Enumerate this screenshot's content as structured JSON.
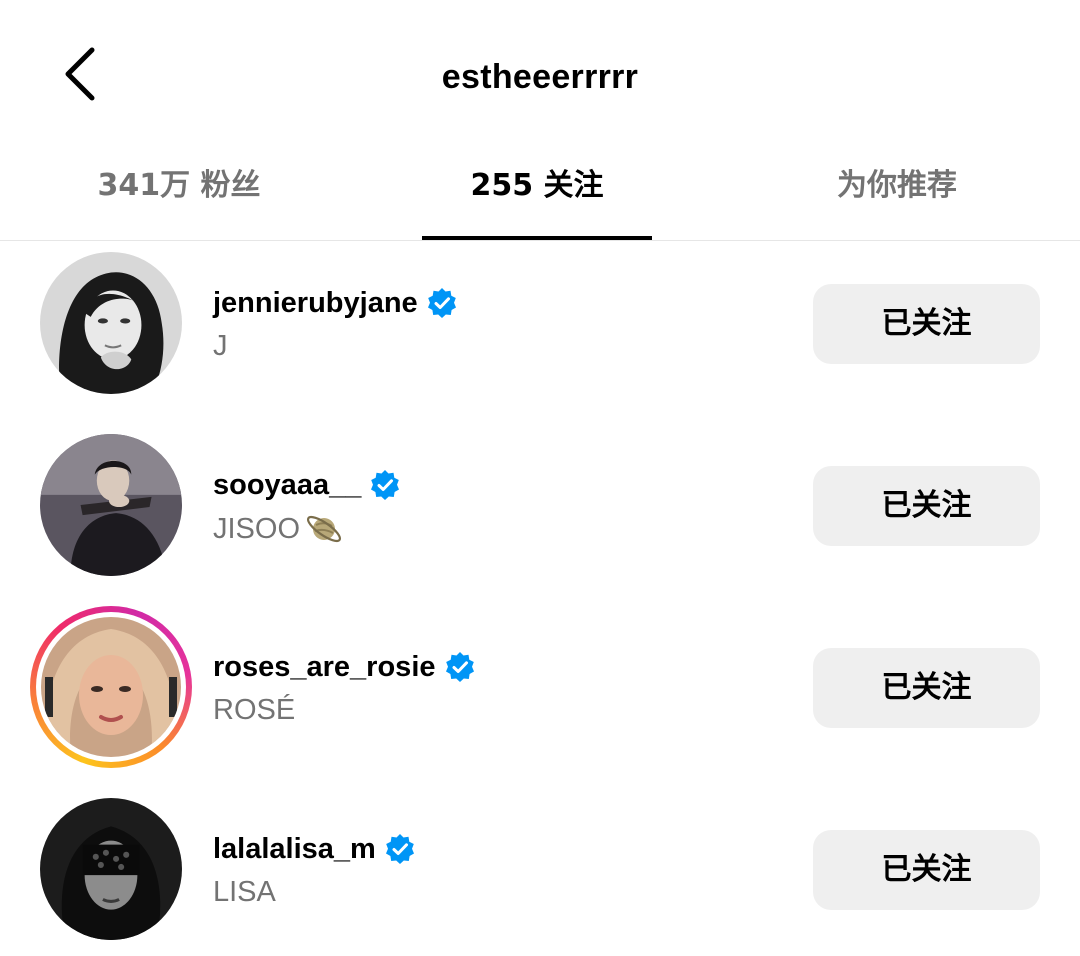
{
  "header": {
    "title": "estheeerrrrr",
    "back_icon": "chevron-left-icon"
  },
  "tabs": [
    {
      "label": "341万 粉丝",
      "active": false
    },
    {
      "label": "255 关注",
      "active": true
    },
    {
      "label": "为你推荐",
      "active": false
    }
  ],
  "accounts": [
    {
      "username": "jennierubyjane",
      "display_name": "J",
      "verified": true,
      "story_ring": false,
      "button_label": "已关注"
    },
    {
      "username": "sooyaaa__",
      "display_name": "JISOO",
      "display_icon": "ringed-planet-icon",
      "verified": true,
      "story_ring": false,
      "button_label": "已关注"
    },
    {
      "username": "roses_are_rosie",
      "display_name": "ROSÉ",
      "verified": true,
      "story_ring": true,
      "button_label": "已关注"
    },
    {
      "username": "lalalalisa_m",
      "display_name": "LISA",
      "verified": true,
      "story_ring": false,
      "button_label": "已关注"
    }
  ],
  "colors": {
    "verified_badge": "#0095f6",
    "secondary_text": "#737373",
    "button_bg": "#efefef",
    "story_ring_start": "#fdc41d",
    "story_ring_end": "#d12aa6"
  }
}
